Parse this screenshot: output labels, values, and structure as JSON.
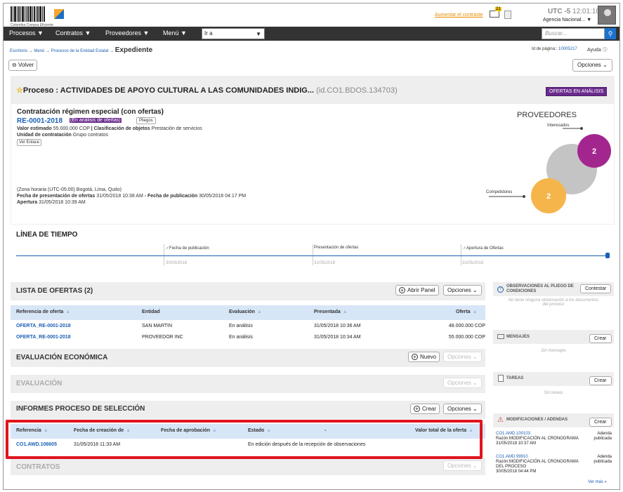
{
  "header": {
    "logo_text": "Colombia Compra Eficiente",
    "contrast_link": "Aumentar el contraste",
    "mail_count": "21",
    "utc_label": "UTC -5",
    "clock": "12:01:10",
    "agency": "Agencia Nacional..."
  },
  "nav": {
    "items": [
      "Procesos",
      "Contratos",
      "Proveedores",
      "Menú"
    ],
    "ira_value": "Ir a",
    "search_placeholder": "Buscar..."
  },
  "breadcrumb": {
    "items": [
      "Escritorio",
      "Menú",
      "Procesos de la Entidad Estatal"
    ],
    "current": "Expediente"
  },
  "page_id": {
    "label": "Id de página::",
    "value": "10005217"
  },
  "help": "Ayuda",
  "buttons": {
    "back": "Volver",
    "options": "Opciones"
  },
  "process": {
    "title": "Proceso : ACTIVIDADES DE APOYO CULTURAL A LAS COMUNIDADES INDIG...",
    "id": "(id.CO1.BDOS.134703)",
    "status_badge": "OFERTAS EN ANÁLISIS",
    "contract_type": "Contratación régimen especial (con ofertas)",
    "reference": "RE-0001-2018",
    "ref_status": "(En análisis de ofertas)",
    "pliegos": "Pliegos",
    "valor_label": "Valor estimado",
    "valor": "55.000.000 COP",
    "clasif_label": "| Clasificación de objetos",
    "clasif": "Prestación de servicios",
    "unidad_label": "Unidad de contratación",
    "unidad": "Grupo contratos",
    "ver_enlace": "Ver Enlace",
    "timezone": "(Zona horaria (UTC-05:00) Bogotá, Lima, Quito)",
    "presentacion_label": "Fecha de presentación de ofertas",
    "presentacion": "31/05/2018 10:38 AM",
    "publicacion_label": "- Fecha de publicación",
    "publicacion": "30/05/2018 04:17 PM",
    "apertura_label": "Apertura",
    "apertura": "31/05/2018 10:39 AM"
  },
  "providers": {
    "title": "PROVEEDORES",
    "interesados_label": "Interesados",
    "interesados": "2",
    "competidores_label": "Competidores",
    "competidores": "2",
    "colors": {
      "interesados": "#a3268f",
      "competidores": "#f5b54a",
      "total": "#c4c4c4"
    }
  },
  "timeline": {
    "title": "LÍNEA DE TIEMPO",
    "events": [
      {
        "label": "Fecha de publicación",
        "date": "30/05/2018",
        "check": "✓"
      },
      {
        "label": "Presentación de ofertas",
        "date": "31/05/2018",
        "check": ""
      },
      {
        "label": "Apertura de Ofertas",
        "date": "31/05/2018",
        "check": "✓"
      }
    ]
  },
  "ofertas": {
    "title": "LISTA DE OFERTAS (2)",
    "open_panel": "Abrir Panel",
    "options": "Opciones",
    "columns": [
      "Referencia de oferta",
      "Entidad",
      "Evaluación",
      "Presentada",
      "Oferta"
    ],
    "rows": [
      [
        "OFERTA_RE-0001-2018",
        "SAN MARTIN",
        "En análisis",
        "31/05/2018 10:36 AM",
        "48.000.000 COP"
      ],
      [
        "OFERTA_RE-0001-2018",
        "PROVEEDOR INC",
        "En análisis",
        "31/05/2018 10:34 AM",
        "55.000.000 COP"
      ]
    ]
  },
  "eval_economica": {
    "title": "EVALUACIÓN ECONÓMICA",
    "new": "Nuevo",
    "options": "Opciones"
  },
  "evaluacion": {
    "title": "EVALUACIÓN",
    "options": "Opciones"
  },
  "informes": {
    "title": "INFORMES PROCESO DE SELECCIÓN",
    "create": "Crear",
    "options": "Opciones",
    "columns": [
      "Referencia",
      "Fecha de creación de",
      "Fecha de aprobación",
      "Estado",
      "-",
      "Valor total de la oferta"
    ],
    "rows": [
      [
        "CO1.AWD.106605",
        "31/05/2018 11:33 AM",
        "",
        "En edición después de la recepción de observaciones",
        "",
        ""
      ]
    ]
  },
  "contratos": {
    "title": "CONTRATOS",
    "options": "Opciones"
  },
  "sidebar": {
    "observaciones": {
      "title": "OBSERVACIONES AL PLIEGO DE CONDICIONES",
      "button": "Contestar",
      "empty": "No tiene ninguna observación a los documentos del proceso"
    },
    "mensajes": {
      "title": "MENSAJES",
      "button": "Crear",
      "empty": "Sin mensajes"
    },
    "tareas": {
      "title": "TAREAS",
      "button": "Crear",
      "empty": "Sin tareas"
    },
    "modificaciones": {
      "title": "MODIFICACIONES / ADENDAS",
      "button": "Crear",
      "items": [
        {
          "id": "CO1.AMD.100103",
          "razon": "Razón:MODIFICACIÓN AL CRONOGRAMA",
          "date": "31/05/2018 10:37 AM",
          "status": "Adenda publicada"
        },
        {
          "id": "CO1.AMD.99910",
          "razon": "Razón:MODIFICACIÓN AL CRONOGRAMA DEL PROCESO",
          "date": "30/05/2018 04:44 PM",
          "status": "Adenda publicada"
        }
      ],
      "more": "Ver más »"
    }
  }
}
